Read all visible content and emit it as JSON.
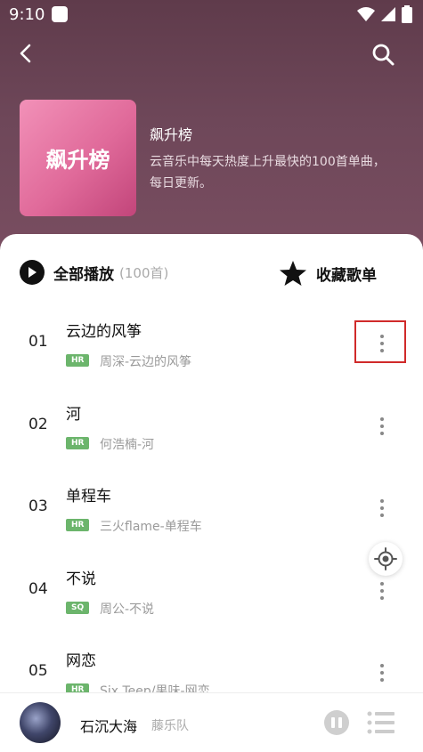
{
  "status": {
    "time": "9:10"
  },
  "header": {
    "cover_text": "飙升榜",
    "title": "飙升榜",
    "description": "云音乐中每天热度上升最快的100首单曲，每日更新。"
  },
  "actions": {
    "play_all": "全部播放",
    "count": "(100首)",
    "collect": "收藏歌单"
  },
  "songs": [
    {
      "num": "01",
      "name": "云边的风筝",
      "badge": "HR",
      "artist": "周深-云边的风筝"
    },
    {
      "num": "02",
      "name": "河",
      "badge": "HR",
      "artist": "何浩楠-河"
    },
    {
      "num": "03",
      "name": "单程车",
      "badge": "HR",
      "artist": "三火flame-单程车"
    },
    {
      "num": "04",
      "name": "不说",
      "badge": "SQ",
      "artist": "周公-不说"
    },
    {
      "num": "05",
      "name": "网恋",
      "badge": "HR",
      "artist": "Six Teep/果味-网恋"
    }
  ],
  "player": {
    "song": "石沉大海",
    "artist": "藤乐队"
  },
  "colors": {
    "accent_badge": "#6cb56c",
    "highlight": "#d02a2a"
  }
}
